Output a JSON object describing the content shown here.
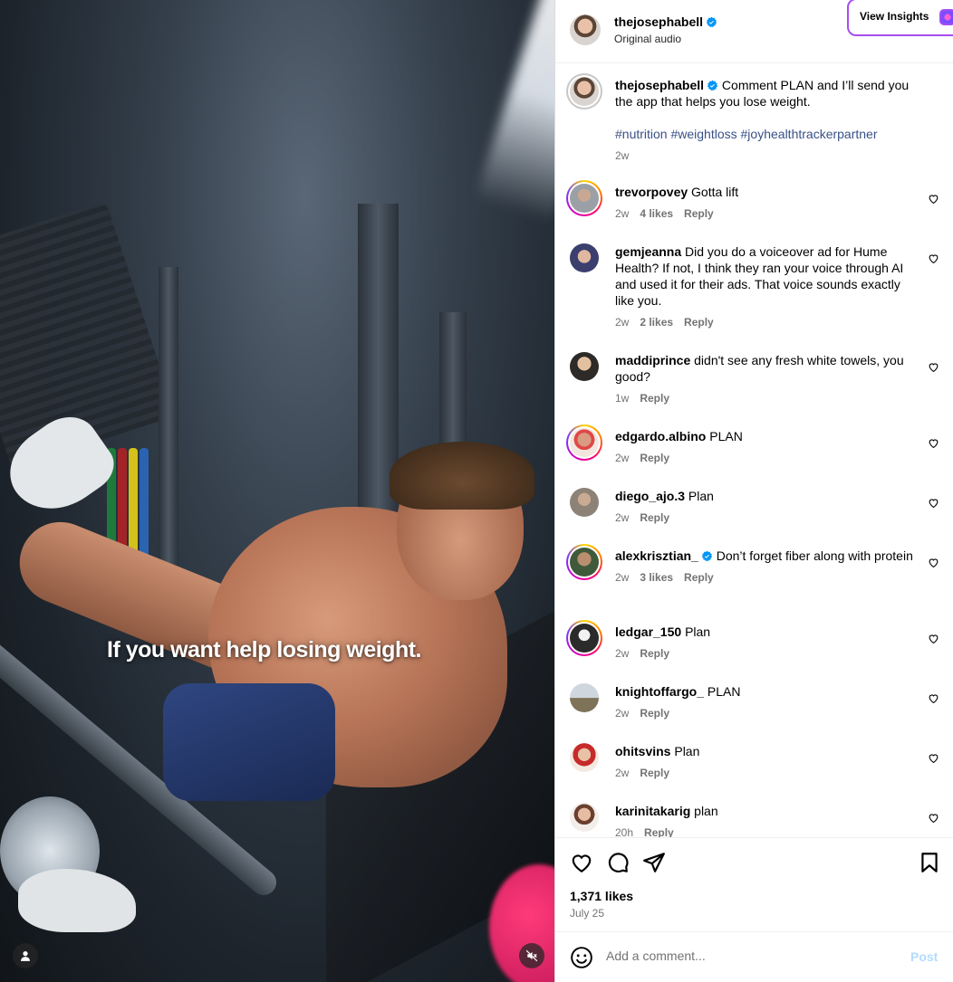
{
  "video": {
    "caption": "If you want help losing weight.",
    "icons": [
      "user-icon",
      "muted-speaker-icon"
    ]
  },
  "header": {
    "username": "thejosephabell",
    "verified": true,
    "audio": "Original audio",
    "insights_label": "View Insights"
  },
  "caption": {
    "username": "thejosephabell",
    "text": "Comment PLAN and I’ll send you the app that helps you lose weight.",
    "hashtags": "#nutrition #weightloss #joyhealthtrackerpartner",
    "time": "2w"
  },
  "comments": [
    {
      "username": "trevorpovey",
      "verified": false,
      "text": "Gotta lift",
      "time": "2w",
      "likes": "4 likes",
      "reply": "Reply",
      "story_ring": true
    },
    {
      "username": "gemjeanna",
      "verified": false,
      "text": "Did you do a voiceover ad for Hume Health? If not, I think they ran your voice through AI and used it for their ads. That voice sounds exactly like you.",
      "time": "2w",
      "likes": "2 likes",
      "reply": "Reply",
      "story_ring": false
    },
    {
      "username": "maddiprince",
      "verified": false,
      "text": "didn't see any fresh white towels, you good?",
      "time": "1w",
      "likes": "",
      "reply": "Reply",
      "story_ring": false
    },
    {
      "username": "edgardo.albino",
      "verified": false,
      "text": "PLAN",
      "time": "2w",
      "likes": "",
      "reply": "Reply",
      "story_ring": true
    },
    {
      "username": "diego_ajo.3",
      "verified": false,
      "text": "Plan",
      "time": "2w",
      "likes": "",
      "reply": "Reply",
      "story_ring": false
    },
    {
      "username": "alexkrisztian_",
      "verified": true,
      "text": "Don’t forget fiber along with protein",
      "time": "2w",
      "likes": "3 likes",
      "reply": "Reply",
      "story_ring": true
    },
    {
      "username": "ledgar_150",
      "verified": false,
      "text": "Plan",
      "time": "2w",
      "likes": "",
      "reply": "Reply",
      "story_ring": true
    },
    {
      "username": "knightoffargo_",
      "verified": false,
      "text": "PLAN",
      "time": "2w",
      "likes": "",
      "reply": "Reply",
      "story_ring": false
    },
    {
      "username": "ohitsvins",
      "verified": false,
      "text": "Plan",
      "time": "2w",
      "likes": "",
      "reply": "Reply",
      "story_ring": false
    },
    {
      "username": "karinitakarig",
      "verified": false,
      "text": "plan",
      "time": "20h",
      "likes": "",
      "reply": "Reply",
      "story_ring": false
    }
  ],
  "actions": {
    "icons": [
      "heart-icon",
      "comment-icon",
      "share-icon",
      "bookmark-icon"
    ],
    "likes": "1,371 likes",
    "date": "July 25"
  },
  "composer": {
    "placeholder": "Add a comment...",
    "post_label": "Post"
  },
  "colors": {
    "link_blue": "#385185",
    "verified_blue": "#0095f6",
    "post_disabled": "#b3dbff",
    "insights_border": "#a64df2"
  }
}
